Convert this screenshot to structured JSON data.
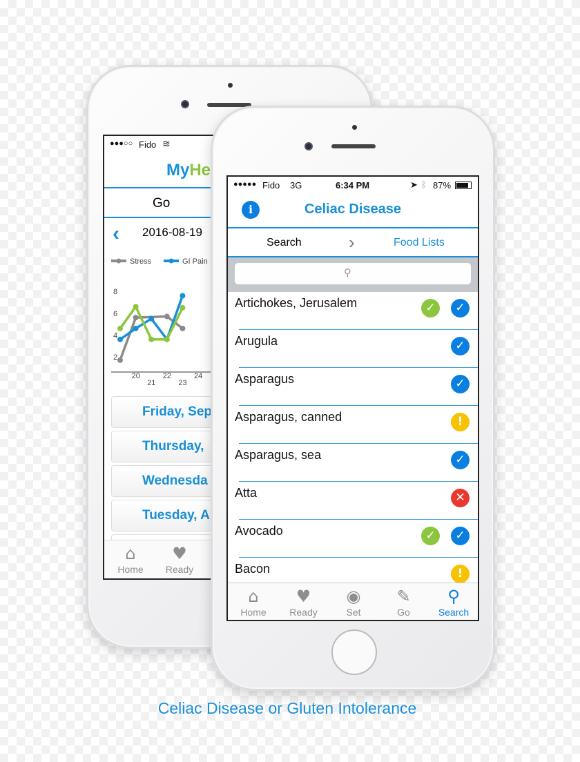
{
  "colors": {
    "accent": "#1a8fd8",
    "ios_blue": "#0a7fe0",
    "green": "#8cc63f",
    "yellow": "#f7c200",
    "red": "#e8382f",
    "gray": "#8e8e8e"
  },
  "back_phone": {
    "status": {
      "signal": "●●●○○",
      "carrier": "Fido",
      "wifi_icon": "wifi-icon"
    },
    "app_title_part1": "My",
    "app_title_part2": "He",
    "section": "Go",
    "date": "2016-08-19",
    "chart_data": {
      "type": "line",
      "series": [
        {
          "name": "Stress",
          "color": "#8a8a8a",
          "x": [
            19,
            20,
            22,
            23
          ],
          "y": [
            1.7,
            5.6,
            5.7,
            4.6
          ]
        },
        {
          "name": "GI Pain",
          "color": "#1a8fd8",
          "x": [
            19,
            20,
            21,
            22,
            23
          ],
          "y": [
            3.6,
            4.6,
            5.5,
            3.6,
            7.6
          ]
        },
        {
          "name": "",
          "color": "#8cc63f",
          "x": [
            19,
            20,
            21,
            22,
            23
          ],
          "y": [
            4.6,
            6.6,
            3.6,
            3.6,
            6.5
          ]
        }
      ],
      "yticks": [
        "2",
        "4",
        "6",
        "8"
      ],
      "xticks": [
        "20",
        "21",
        "22",
        "23",
        "24"
      ],
      "xlim": [
        18.7,
        24.5
      ],
      "ylim": [
        0.5,
        9
      ],
      "legend": "top"
    },
    "days": [
      "Friday, Sep",
      "Thursday,",
      "Wednesda",
      "Tuesday, A"
    ],
    "tabs": [
      {
        "label": "Home",
        "icon": "home-icon"
      },
      {
        "label": "Ready",
        "icon": "apple-icon"
      }
    ]
  },
  "front_phone": {
    "status": {
      "signal": "●●●●●",
      "carrier": "Fido",
      "network": "3G",
      "time": "6:34 PM",
      "battery": "87%"
    },
    "header": {
      "title": "Celiac Disease",
      "info_icon": "i"
    },
    "breadcrumb": {
      "back": "Search",
      "current": "Food Lists"
    },
    "search": {
      "placeholder": ""
    },
    "foods": [
      {
        "name": "Artichokes, Jerusalem",
        "icons": [
          "green-check",
          "blue-check"
        ]
      },
      {
        "name": "Arugula",
        "icons": [
          "blue-check"
        ]
      },
      {
        "name": "Asparagus",
        "icons": [
          "blue-check"
        ]
      },
      {
        "name": "Asparagus, canned",
        "icons": [
          "yellow-warning"
        ]
      },
      {
        "name": "Asparagus, sea",
        "icons": [
          "blue-check"
        ]
      },
      {
        "name": "Atta",
        "icons": [
          "red-x"
        ]
      },
      {
        "name": "Avocado",
        "icons": [
          "green-check",
          "blue-check"
        ]
      },
      {
        "name": "Bacon",
        "icons": [
          "yellow-warning"
        ]
      }
    ],
    "tabs": [
      {
        "label": "Home",
        "glyph": "⌂",
        "active": false
      },
      {
        "label": "Ready",
        "glyph": "♥",
        "active": false
      },
      {
        "label": "Set",
        "glyph": "◉",
        "active": false
      },
      {
        "label": "Go",
        "glyph": "✎",
        "active": false
      },
      {
        "label": "Search",
        "glyph": "⚲",
        "active": true
      }
    ]
  },
  "caption": "Celiac Disease or Gluten Intolerance"
}
